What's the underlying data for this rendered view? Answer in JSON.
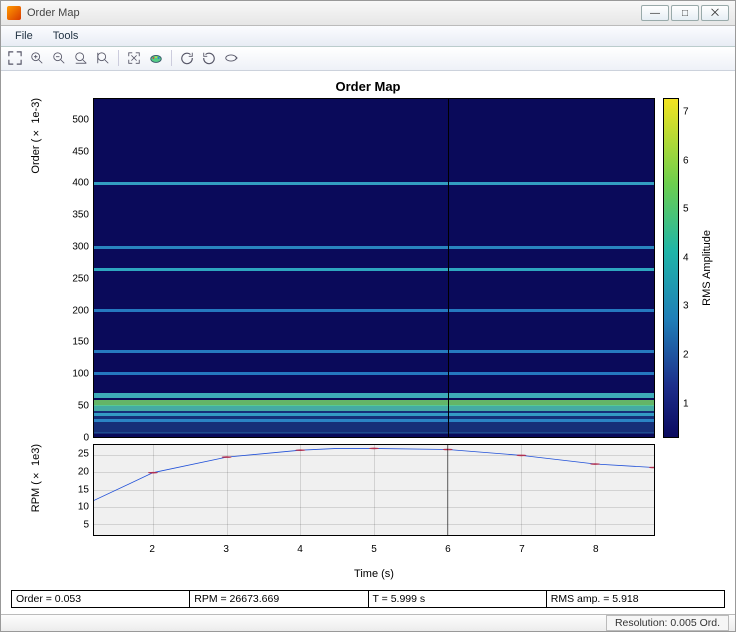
{
  "window": {
    "title": "Order Map",
    "buttons": {
      "min": "—",
      "max": "□",
      "close": "⨉"
    }
  },
  "menu": {
    "items": [
      "File",
      "Tools"
    ]
  },
  "toolbar": {
    "icons": [
      "expand-arrows-icon",
      "zoom-in-icon",
      "zoom-out-icon",
      "zoom-x-icon",
      "zoom-y-icon",
      "sep",
      "fit-icon",
      "palette-icon",
      "sep",
      "rotate-ccw-icon",
      "rotate-cw-icon",
      "loop-icon"
    ]
  },
  "chart": {
    "title": "Order Map"
  },
  "heatmap": {
    "ylabel": "Order (× 1e-3)",
    "yticks": [
      0,
      50,
      100,
      150,
      200,
      250,
      300,
      350,
      400,
      450,
      500
    ],
    "cursor_time": 6.0
  },
  "colorbar": {
    "label": "RMS Amplitude",
    "ticks": [
      1,
      2,
      3,
      4,
      5,
      6,
      7
    ]
  },
  "rpm": {
    "ylabel": "RPM (× 1e3)",
    "yticks": [
      5,
      10,
      15,
      20,
      25
    ],
    "xlabel": "Time (s)",
    "xticks": [
      2,
      3,
      4,
      5,
      6,
      7,
      8
    ]
  },
  "status": {
    "order": "Order = 0.053",
    "rpm": "RPM = 26673.669",
    "t": "T = 5.999 s",
    "rms": "RMS amp. = 5.918"
  },
  "footer": {
    "resolution": "Resolution: 0.005 Ord."
  },
  "chart_data": {
    "type": "heatmap_plus_line",
    "order_map": {
      "x_axis": "Time (s)",
      "x_range": [
        1.2,
        8.8
      ],
      "y_axis": "Order (×1e-3)",
      "y_range": [
        0,
        535
      ],
      "colorbar_label": "RMS Amplitude",
      "c_range": [
        0.3,
        7.3
      ],
      "prominent_order_lines_1e3": [
        400,
        300,
        265,
        200,
        135,
        100,
        65,
        53,
        45,
        35,
        25
      ],
      "cursor_time_s": 5.999
    },
    "rpm_curve": {
      "x": [
        1.2,
        2.0,
        3.0,
        4.0,
        4.5,
        5.0,
        6.0,
        7.0,
        8.0,
        8.8
      ],
      "rpm_1e3": [
        12,
        20,
        24.5,
        26.5,
        27.0,
        27.0,
        26.7,
        25.0,
        22.5,
        21.5
      ],
      "marker_x": [
        2.0,
        3.0,
        4.0,
        5.0,
        6.0,
        7.0,
        8.0,
        8.8
      ],
      "marker_rpm_1e3": [
        20,
        24.5,
        26.5,
        27.0,
        26.7,
        25.0,
        22.5,
        21.5
      ]
    },
    "cursor_readout": {
      "order": 0.053,
      "rpm": 26673.669,
      "t_s": 5.999,
      "rms_amp": 5.918
    }
  }
}
